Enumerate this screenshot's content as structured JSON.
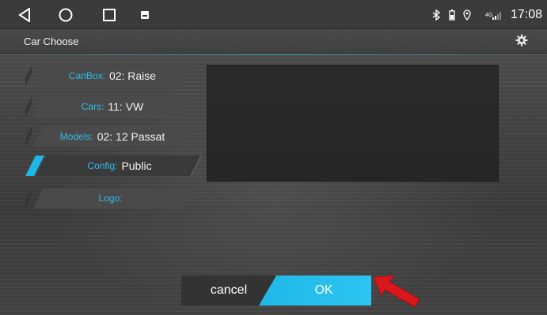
{
  "status_bar": {
    "clock": "17:08",
    "nav_icons": [
      "back-icon",
      "home-icon",
      "recents-icon",
      "notification-icon"
    ],
    "status_icons": [
      "bluetooth-icon",
      "battery-icon",
      "location-icon",
      "signal-icon"
    ]
  },
  "title_bar": {
    "title": "Car Choose",
    "settings_icon": "gear-icon"
  },
  "options": [
    {
      "label": "CanBox:",
      "value": "02: Raise"
    },
    {
      "label": "Cars:",
      "value": "11: VW"
    },
    {
      "label": "Models:",
      "value": "02: 12 Passat"
    },
    {
      "label": "Config:",
      "value": "Public",
      "selected": true
    },
    {
      "label": "Logo:",
      "value": ""
    }
  ],
  "buttons": {
    "cancel": "cancel",
    "ok": "OK"
  },
  "colors": {
    "accent": "#1fb6e8",
    "label": "#2dbde9",
    "annotation_arrow": "#d9171c"
  }
}
